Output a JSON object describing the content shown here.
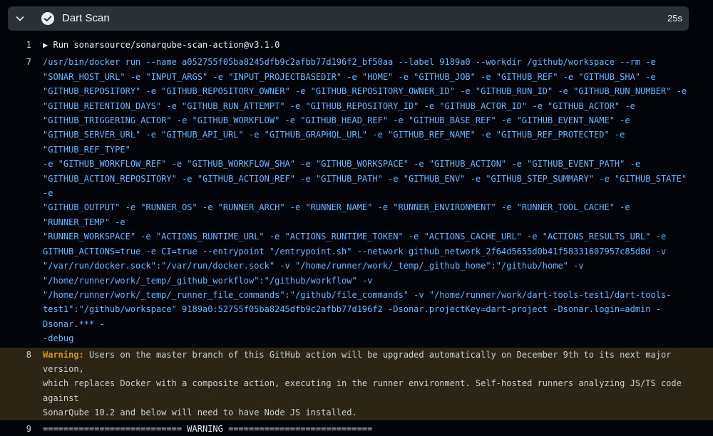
{
  "step": {
    "title": "Dart Scan",
    "duration": "25s",
    "status": "success",
    "icons": {
      "expand": "chevron-down-icon",
      "status": "check-circle-icon"
    }
  },
  "log": {
    "lines": [
      {
        "number": "1",
        "group_arrow": "▶",
        "text": "Run sonarsource/sonarqube-scan-action@v3.1.0"
      },
      {
        "number": "7",
        "rows": [
          "/usr/bin/docker run --name a052755f05ba8245dfb9c2afbb77d196f2_bf50aa --label 9189a0 --workdir /github/workspace --rm -e",
          "\"SONAR_HOST_URL\" -e \"INPUT_ARGS\" -e \"INPUT_PROJECTBASEDIR\" -e \"HOME\" -e \"GITHUB_JOB\" -e \"GITHUB_REF\" -e \"GITHUB_SHA\" -e",
          "\"GITHUB_REPOSITORY\" -e \"GITHUB_REPOSITORY_OWNER\" -e \"GITHUB_REPOSITORY_OWNER_ID\" -e \"GITHUB_RUN_ID\" -e \"GITHUB_RUN_NUMBER\" -e",
          "\"GITHUB_RETENTION_DAYS\" -e \"GITHUB_RUN_ATTEMPT\" -e \"GITHUB_REPOSITORY_ID\" -e \"GITHUB_ACTOR_ID\" -e \"GITHUB_ACTOR\" -e",
          "\"GITHUB_TRIGGERING_ACTOR\" -e \"GITHUB_WORKFLOW\" -e \"GITHUB_HEAD_REF\" -e \"GITHUB_BASE_REF\" -e \"GITHUB_EVENT_NAME\" -e",
          "\"GITHUB_SERVER_URL\" -e \"GITHUB_API_URL\" -e \"GITHUB_GRAPHQL_URL\" -e \"GITHUB_REF_NAME\" -e \"GITHUB_REF_PROTECTED\" -e \"GITHUB_REF_TYPE\"",
          "-e \"GITHUB_WORKFLOW_REF\" -e \"GITHUB_WORKFLOW_SHA\" -e \"GITHUB_WORKSPACE\" -e \"GITHUB_ACTION\" -e \"GITHUB_EVENT_PATH\" -e",
          "\"GITHUB_ACTION_REPOSITORY\" -e \"GITHUB_ACTION_REF\" -e \"GITHUB_PATH\" -e \"GITHUB_ENV\" -e \"GITHUB_STEP_SUMMARY\" -e \"GITHUB_STATE\" -e",
          "\"GITHUB_OUTPUT\" -e \"RUNNER_OS\" -e \"RUNNER_ARCH\" -e \"RUNNER_NAME\" -e \"RUNNER_ENVIRONMENT\" -e \"RUNNER_TOOL_CACHE\" -e \"RUNNER_TEMP\" -e",
          "\"RUNNER_WORKSPACE\" -e \"ACTIONS_RUNTIME_URL\" -e \"ACTIONS_RUNTIME_TOKEN\" -e \"ACTIONS_CACHE_URL\" -e \"ACTIONS_RESULTS_URL\" -e",
          "GITHUB_ACTIONS=true -e CI=true --entrypoint \"/entrypoint.sh\" --network github_network_2f64d5655d0b41f58331607957c85d8d -v",
          "\"/var/run/docker.sock\":\"/var/run/docker.sock\" -v \"/home/runner/work/_temp/_github_home\":\"/github/home\" -v",
          "\"/home/runner/work/_temp/_github_workflow\":\"/github/workflow\" -v",
          "\"/home/runner/work/_temp/_runner_file_commands\":\"/github/file_commands\" -v \"/home/runner/work/dart-tools-test1/dart-tools-",
          "test1\":\"/github/workspace\" 9189a0:52755f05ba8245dfb9c2afbb77d196f2 -Dsonar.projectKey=dart-project -Dsonar.login=admin -Dsonar.*** -",
          "-debug"
        ]
      },
      {
        "number": "8",
        "label": "Warning:",
        "rows": [
          " Users on the master branch of this GitHub action will be upgraded automatically on December 9th to its next major version,",
          "which replaces Docker with a composite action, executing in the runner environment. Self-hosted runners analyzing JS/TS code against",
          "SonarQube 10.2 and below will need to have Node JS installed."
        ]
      },
      {
        "number": "9",
        "text": "=========================== WARNING ============================"
      }
    ]
  },
  "colors": {
    "background": "#010409",
    "header_bg": "#2b3138",
    "command_text": "#6cb6ff",
    "warning_label": "#d29922",
    "warning_bg": "#2c2415",
    "success": "#e6edf3"
  }
}
